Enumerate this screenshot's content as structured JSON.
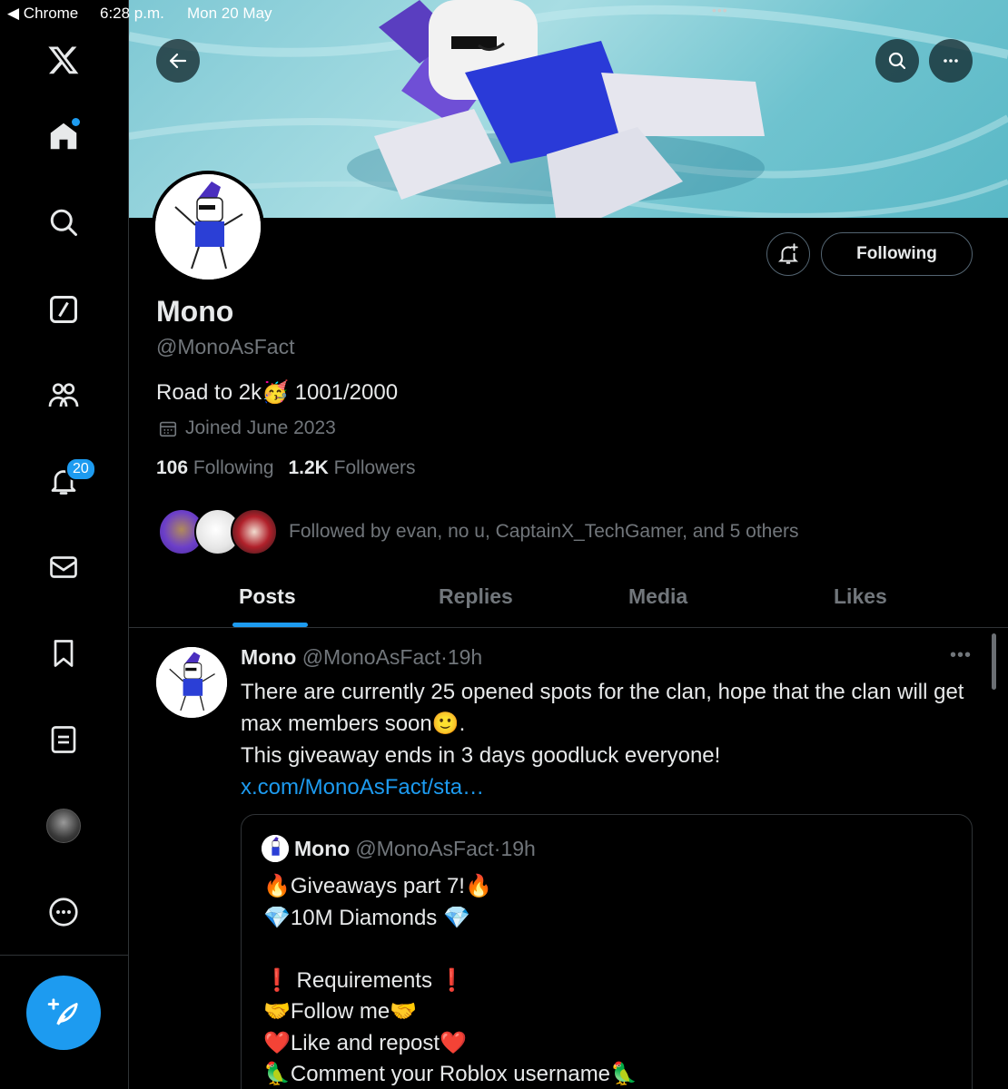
{
  "status_bar": {
    "back_label": "◀ Chrome",
    "time": "6:28 p.m.",
    "date": "Mon 20 May",
    "dots": "•••"
  },
  "sidebar": {
    "items": [
      {
        "name": "x-logo",
        "icon": "x-logo-icon"
      },
      {
        "name": "home",
        "icon": "home-icon",
        "has_dot": true
      },
      {
        "name": "explore",
        "icon": "search-icon"
      },
      {
        "name": "grok",
        "icon": "slash-square-icon"
      },
      {
        "name": "communities",
        "icon": "people-icon"
      },
      {
        "name": "notifications",
        "icon": "bell-icon",
        "badge": "20"
      },
      {
        "name": "messages",
        "icon": "envelope-icon"
      },
      {
        "name": "bookmarks",
        "icon": "bookmark-icon"
      },
      {
        "name": "lists",
        "icon": "list-icon"
      },
      {
        "name": "profile",
        "icon": "avatar"
      },
      {
        "name": "more",
        "icon": "more-circle-icon"
      }
    ],
    "compose_icon": "feather-plus-icon"
  },
  "profile": {
    "name": "Mono",
    "handle": "@MonoAsFact",
    "bio": "Road to 2k🥳 1001/2000",
    "joined": "Joined June 2023",
    "following_count": "106",
    "following_label": "Following",
    "followers_count": "1.2K",
    "followers_label": "Followers",
    "followed_by": "Followed by evan, no u, CaptainX_TechGamer, and 5 others",
    "follow_button": "Following"
  },
  "tabs": [
    {
      "label": "Posts",
      "active": true
    },
    {
      "label": "Replies",
      "active": false
    },
    {
      "label": "Media",
      "active": false
    },
    {
      "label": "Likes",
      "active": false
    }
  ],
  "post": {
    "name": "Mono",
    "handle": "@MonoAsFact",
    "separator": "·",
    "time": "19h",
    "more": "•••",
    "text_line1": "There are currently 25 opened spots for the clan, hope that the clan will get max members soon🙂.",
    "text_line2": "This giveaway ends in 3 days goodluck everyone!",
    "link": "x.com/MonoAsFact/sta…",
    "quote": {
      "name": "Mono",
      "handle": "@MonoAsFact",
      "separator": "·",
      "time": "19h",
      "body": "🔥Giveaways part 7!🔥\n💎10M Diamonds 💎\n\n❗ Requirements ❗\n🤝Follow me🤝\n❤️Like and repost❤️\n🦜Comment your Roblox username🦜"
    }
  },
  "colors": {
    "accent": "#1d9bf0",
    "background": "#000000",
    "text": "#e7e9ea",
    "muted": "#71767b",
    "border": "#2f3336"
  }
}
